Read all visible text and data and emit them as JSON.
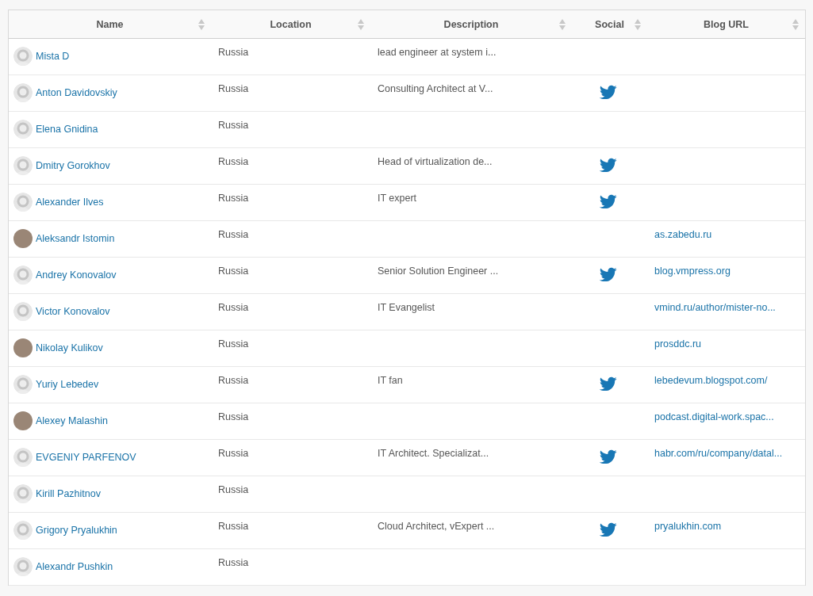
{
  "table": {
    "columns": [
      "Name",
      "Location",
      "Description",
      "Social",
      "Blog URL"
    ],
    "rows": [
      {
        "name": "Mista D",
        "avatar": {
          "kind": "default"
        },
        "location": "Russia",
        "description": "lead engineer at system i...",
        "twitter": false
      },
      {
        "name": "Anton Davidovskiy",
        "avatar": {
          "kind": "default"
        },
        "location": "Russia",
        "description": "Consulting Architect at V...",
        "twitter": true
      },
      {
        "name": "Elena Gnidina",
        "avatar": {
          "kind": "default"
        },
        "location": "Russia",
        "twitter": false
      },
      {
        "name": "Dmitry Gorokhov",
        "avatar": {
          "kind": "default"
        },
        "location": "Russia",
        "description": "Head of virtualization de...",
        "twitter": true
      },
      {
        "name": "Alexander Ilves",
        "avatar": {
          "kind": "default"
        },
        "location": "Russia",
        "description": "IT expert",
        "twitter": true
      },
      {
        "name": "Aleksandr Istomin",
        "avatar": {
          "kind": "photo"
        },
        "location": "Russia",
        "twitter": false,
        "blog": "as.zabedu.ru"
      },
      {
        "name": "Andrey Konovalov",
        "avatar": {
          "kind": "default"
        },
        "location": "Russia",
        "description": "Senior Solution Engineer ...",
        "twitter": true,
        "blog": "blog.vmpress.org"
      },
      {
        "name": "Victor Konovalov",
        "avatar": {
          "kind": "default"
        },
        "location": "Russia",
        "description": "IT Evangelist",
        "twitter": false,
        "blog": "vmind.ru/author/mister-no..."
      },
      {
        "name": "Nikolay Kulikov",
        "avatar": {
          "kind": "photo"
        },
        "location": "Russia",
        "twitter": false,
        "blog": "prosddc.ru"
      },
      {
        "name": "Yuriy Lebedev",
        "avatar": {
          "kind": "default"
        },
        "location": "Russia",
        "description": "IT fan",
        "twitter": true,
        "blog": "lebedevum.blogspot.com/"
      },
      {
        "name": "Alexey Malashin",
        "avatar": {
          "kind": "photo"
        },
        "location": "Russia",
        "twitter": false,
        "blog": "podcast.digital-work.spac..."
      },
      {
        "name": "EVGENIY PARFENOV",
        "avatar": {
          "kind": "default"
        },
        "location": "Russia",
        "description": "IT Architect. Specializat...",
        "twitter": true,
        "blog": "habr.com/ru/company/datal..."
      },
      {
        "name": "Kirill Pazhitnov",
        "avatar": {
          "kind": "default"
        },
        "location": "Russia",
        "twitter": false
      },
      {
        "name": "Grigory Pryalukhin",
        "avatar": {
          "kind": "default"
        },
        "location": "Russia",
        "description": "Cloud Architect, vExpert ...",
        "twitter": true,
        "blog": "pryalukhin.com"
      },
      {
        "name": "Alexandr Pushkin",
        "avatar": {
          "kind": "default"
        },
        "location": "Russia",
        "twitter": false
      }
    ]
  }
}
